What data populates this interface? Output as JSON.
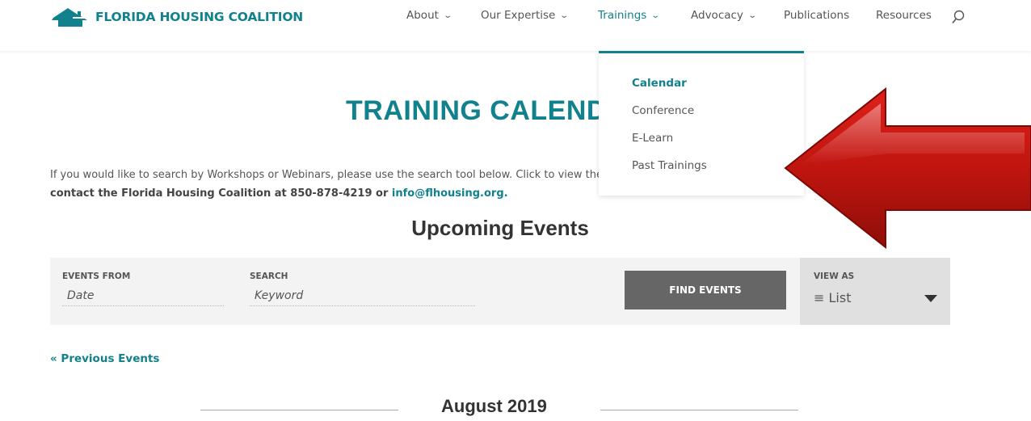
{
  "brand": {
    "name": "FLORIDA HOUSING COALITION",
    "color": "#11818e"
  },
  "nav": {
    "items": [
      {
        "label": "About",
        "chevron": "⌄"
      },
      {
        "label": "Our Expertise",
        "chevron": "⌄"
      },
      {
        "label": "Trainings",
        "chevron": "⌄"
      },
      {
        "label": "Advocacy",
        "chevron": "⌄"
      },
      {
        "label": "Publications"
      },
      {
        "label": "Resources"
      }
    ],
    "search_icon": "search-icon"
  },
  "dropdown": {
    "items": [
      {
        "label": "Calendar"
      },
      {
        "label": "Conference"
      },
      {
        "label": "E-Learn"
      },
      {
        "label": "Past Trainings"
      }
    ]
  },
  "main": {
    "title": "TRAINING CALENDAR",
    "intro_text": "If you would like to search by Workshops or Webinars, please use the search tool below. Click to view the categories. ",
    "intro_bold": "For questions, please contact the Florida Housing Coalition at 850-878-4219 or ",
    "intro_link": "info@flhousing.org.",
    "upcoming_heading": "Upcoming Events",
    "search_bar": {
      "events_from_label": "EVENTS FROM",
      "events_from_placeholder": "Date",
      "search_label": "SEARCH",
      "search_placeholder": "Keyword",
      "find_button": "FIND EVENTS",
      "view_as_label": "VIEW AS",
      "view_as_value": "≡ List"
    },
    "previous_events": "« Previous Events",
    "month": "August 2019"
  },
  "colors": {
    "accent": "#11818e",
    "arrow": "#c0150f",
    "button": "#666666"
  }
}
